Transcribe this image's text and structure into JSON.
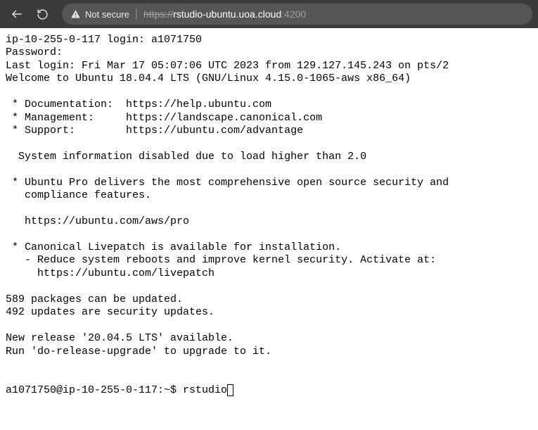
{
  "toolbar": {
    "security_label": "Not secure",
    "url_protocol": "https://",
    "url_host": "rstudio-ubuntu.uoa.cloud",
    "url_port": ":4200"
  },
  "terminal": {
    "login_line": "ip-10-255-0-117 login: a1071750",
    "password_line": "Password:",
    "last_login": "Last login: Fri Mar 17 05:07:06 UTC 2023 from 129.127.145.243 on pts/2",
    "welcome": "Welcome to Ubuntu 18.04.4 LTS (GNU/Linux 4.15.0-1065-aws x86_64)",
    "doc_line": " * Documentation:  https://help.ubuntu.com",
    "mgmt_line": " * Management:     https://landscape.canonical.com",
    "support_line": " * Support:        https://ubuntu.com/advantage",
    "sysinfo_line": "  System information disabled due to load higher than 2.0",
    "ubuntu_pro_1": " * Ubuntu Pro delivers the most comprehensive open source security and",
    "ubuntu_pro_2": "   compliance features.",
    "ubuntu_pro_url": "   https://ubuntu.com/aws/pro",
    "livepatch_1": " * Canonical Livepatch is available for installation.",
    "livepatch_2": "   - Reduce system reboots and improve kernel security. Activate at:",
    "livepatch_3": "     https://ubuntu.com/livepatch",
    "pkg_updates": "589 packages can be updated.",
    "sec_updates": "492 updates are security updates.",
    "new_release": "New release '20.04.5 LTS' available.",
    "upgrade_hint": "Run 'do-release-upgrade' to upgrade to it.",
    "prompt": "a1071750@ip-10-255-0-117:~$ ",
    "command": "rstudio"
  }
}
